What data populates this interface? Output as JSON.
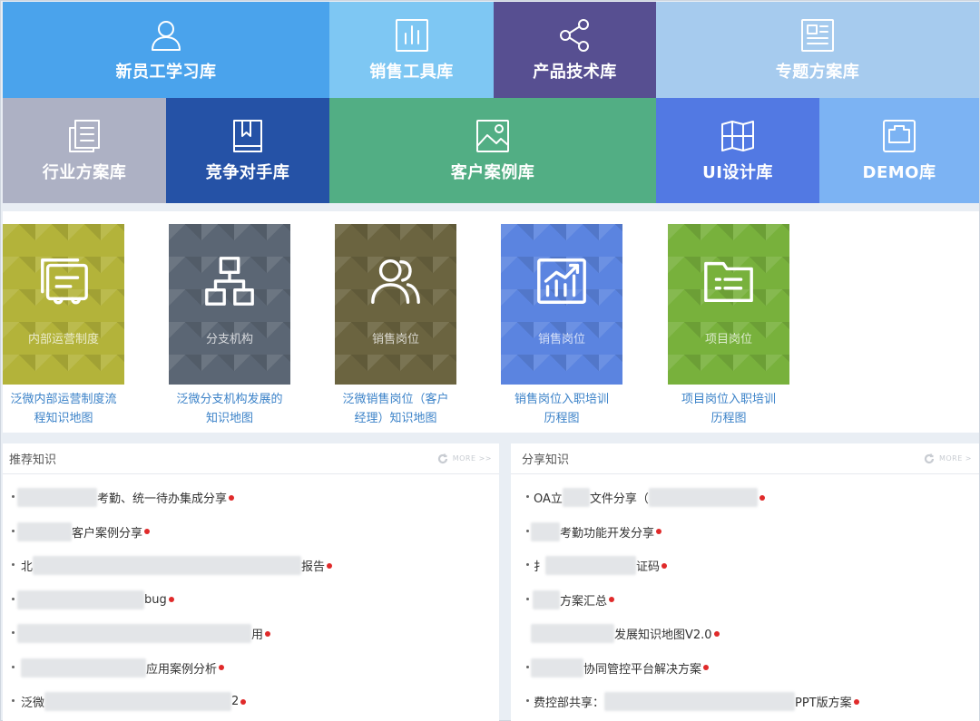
{
  "tiles": [
    {
      "label": "新员工学习库",
      "color": "#4aa3ec",
      "icon": "user-icon"
    },
    {
      "label": "销售工具库",
      "color": "#7ec7f3",
      "icon": "bar-chart-icon"
    },
    {
      "label": "产品技术库",
      "color": "#574f91",
      "icon": "share-icon"
    },
    {
      "label": "专题方案库",
      "color": "#a6cbee",
      "icon": "newspaper-icon"
    },
    {
      "label": "行业方案库",
      "color": "#adb1c4",
      "icon": "document-icon"
    },
    {
      "label": "竞争对手库",
      "color": "#2552a6",
      "icon": "book-icon"
    },
    {
      "label": "客户案例库",
      "color": "#52ae84",
      "icon": "image-icon"
    },
    {
      "label": "UI设计库",
      "color": "#5279e3",
      "icon": "map-icon"
    },
    {
      "label": "DEMO库",
      "color": "#7cb3f3",
      "icon": "ethernet-port-icon"
    }
  ],
  "knowledge_maps": [
    {
      "caption": "内部运营制度",
      "title_line1": "泛微内部运营制度流",
      "title_line2": "程知识地图",
      "color": "#b3b33a",
      "icon": "review-icon"
    },
    {
      "caption": "分支机构",
      "title_line1": "泛微分支机构发展的",
      "title_line2": "知识地图",
      "color": "#5b6674",
      "icon": "org-chart-icon"
    },
    {
      "caption": "销售岗位",
      "title_line1": "泛微销售岗位（客户",
      "title_line2": "经理）知识地图",
      "color": "#6b6440",
      "icon": "people-icon"
    },
    {
      "caption": "销售岗位",
      "title_line1": "销售岗位入职培训",
      "title_line2": "历程图",
      "color": "#5b84e0",
      "icon": "trend-chart-icon"
    },
    {
      "caption": "项目岗位",
      "title_line1": "项目岗位入职培训",
      "title_line2": "历程图",
      "color": "#78b13c",
      "icon": "folder-icon"
    }
  ],
  "recommended": {
    "title": "推荐知识",
    "more_label": "MORE >>",
    "items": [
      {
        "prefix": "",
        "suffix": "考勤、统一待办集成分享"
      },
      {
        "prefix": "",
        "suffix": "客户案例分享"
      },
      {
        "prefix": "北",
        "suffix": "报告"
      },
      {
        "prefix": "",
        "suffix": "bug"
      },
      {
        "prefix": "",
        "suffix": "用"
      },
      {
        "prefix": "",
        "suffix": "应用案例分析"
      },
      {
        "prefix": "泛微",
        "suffix": "2"
      }
    ]
  },
  "shared": {
    "title": "分享知识",
    "more_label": "MORE >",
    "items": [
      {
        "prefix": "OA立",
        "middle": "文件分享（",
        "suffix": ""
      },
      {
        "prefix": "",
        "suffix": "考勤功能开发分享"
      },
      {
        "prefix": "扌",
        "suffix": "证码"
      },
      {
        "prefix": "",
        "suffix": "方案汇总"
      },
      {
        "prefix": "",
        "suffix": "发展知识地图V2.0"
      },
      {
        "prefix": "",
        "suffix": "协同管控平台解决方案"
      },
      {
        "prefix": "费控部共享：",
        "suffix": "PPT版方案"
      }
    ]
  }
}
